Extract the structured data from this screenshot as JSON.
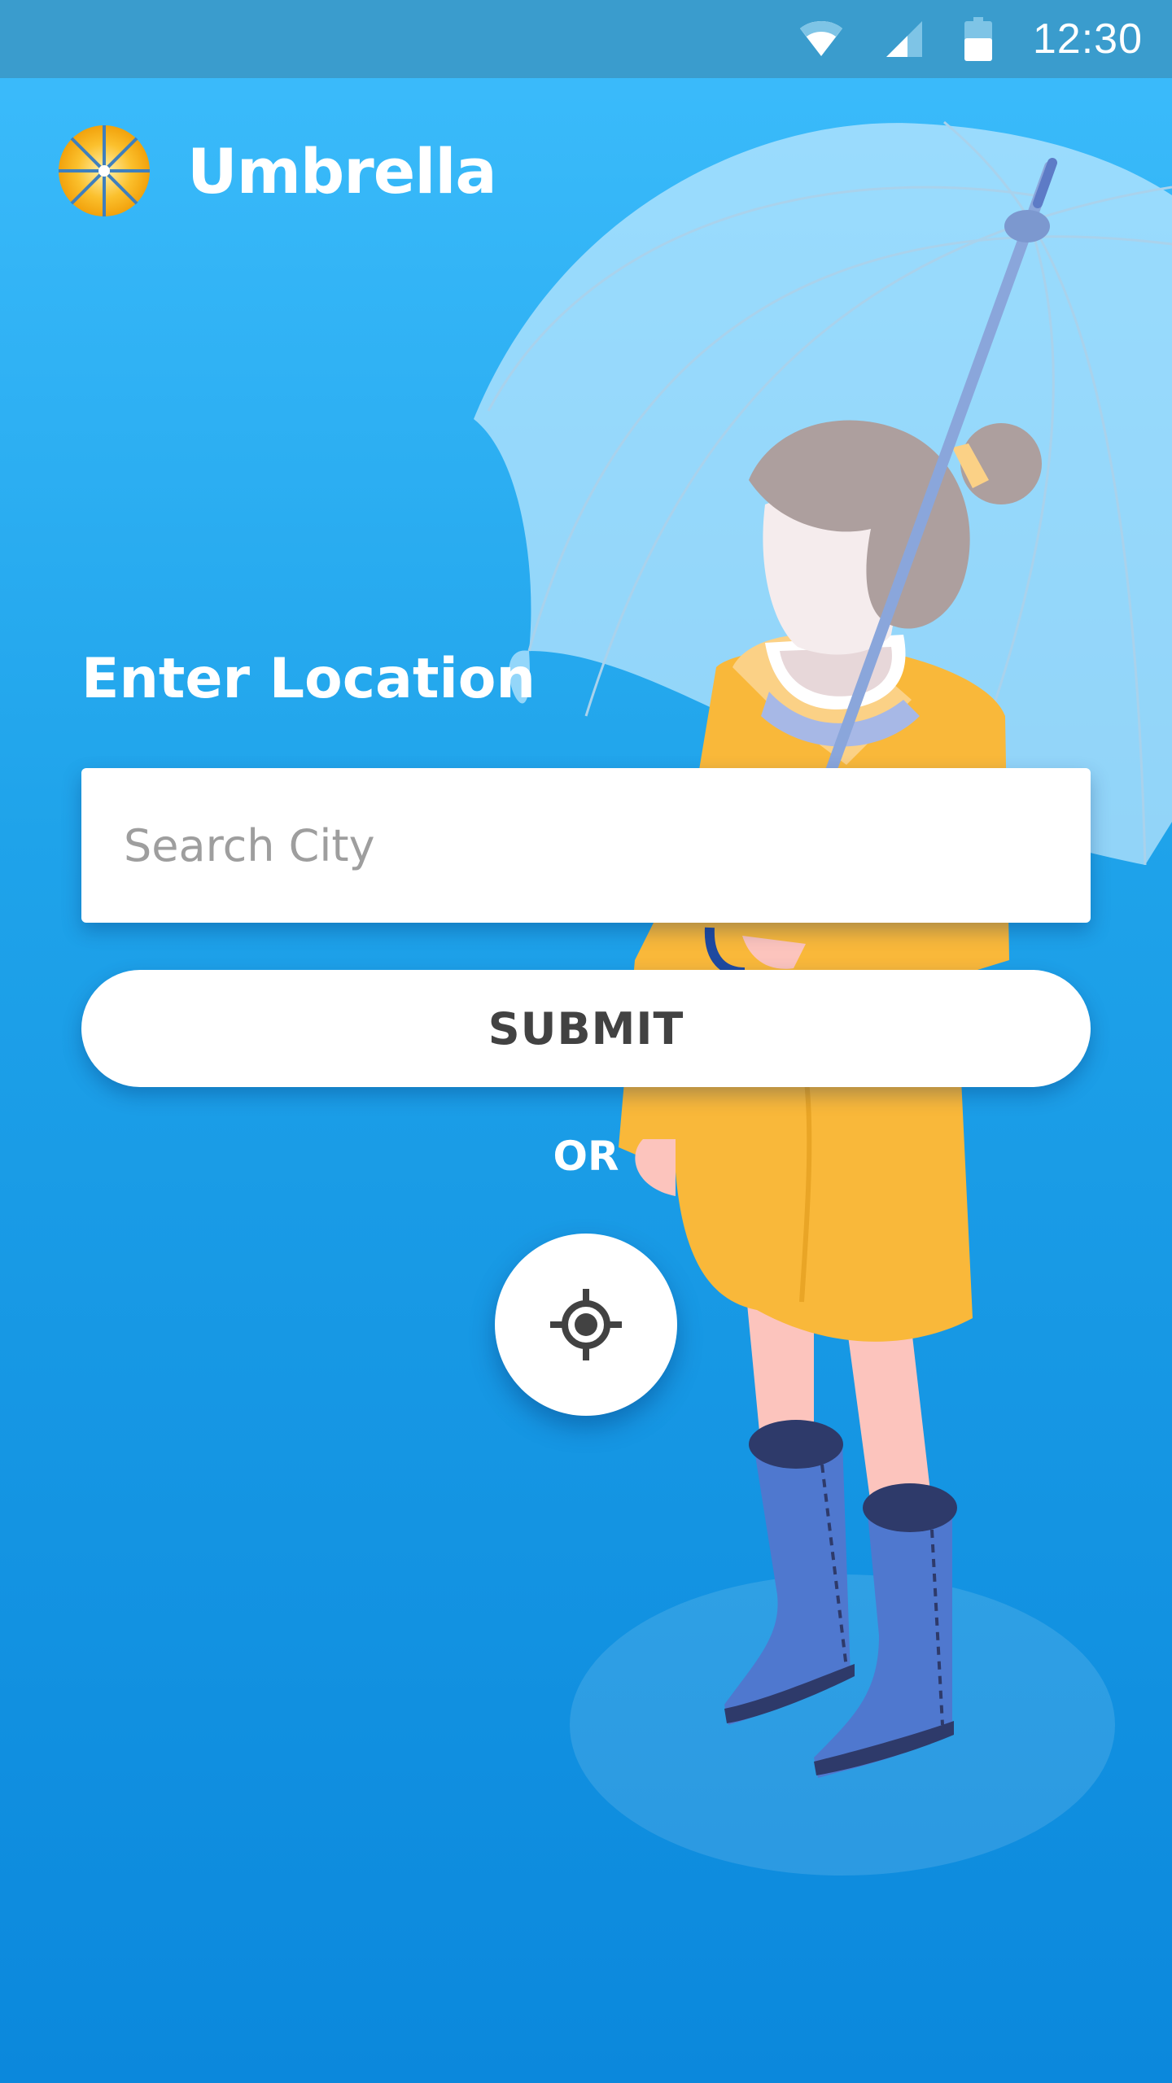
{
  "status_bar": {
    "time": "12:30",
    "icons": [
      "wifi-icon",
      "cell-signal-icon",
      "battery-icon"
    ]
  },
  "app": {
    "title": "Umbrella",
    "logo_icon": "umbrella-logo-icon"
  },
  "form": {
    "section_label": "Enter Location",
    "search_placeholder": "Search City",
    "search_value": "",
    "submit_label": "SUBMIT",
    "or_label": "OR",
    "locate_icon": "gps-crosshair-icon"
  },
  "colors": {
    "background_top": "#3dbdfc",
    "background_bottom": "#0b88dc",
    "status_bar": "#3a9ccd",
    "raincoat": "#f9b83a",
    "boots": "#4f78cf",
    "logo_yellow": "#fbc02d"
  }
}
